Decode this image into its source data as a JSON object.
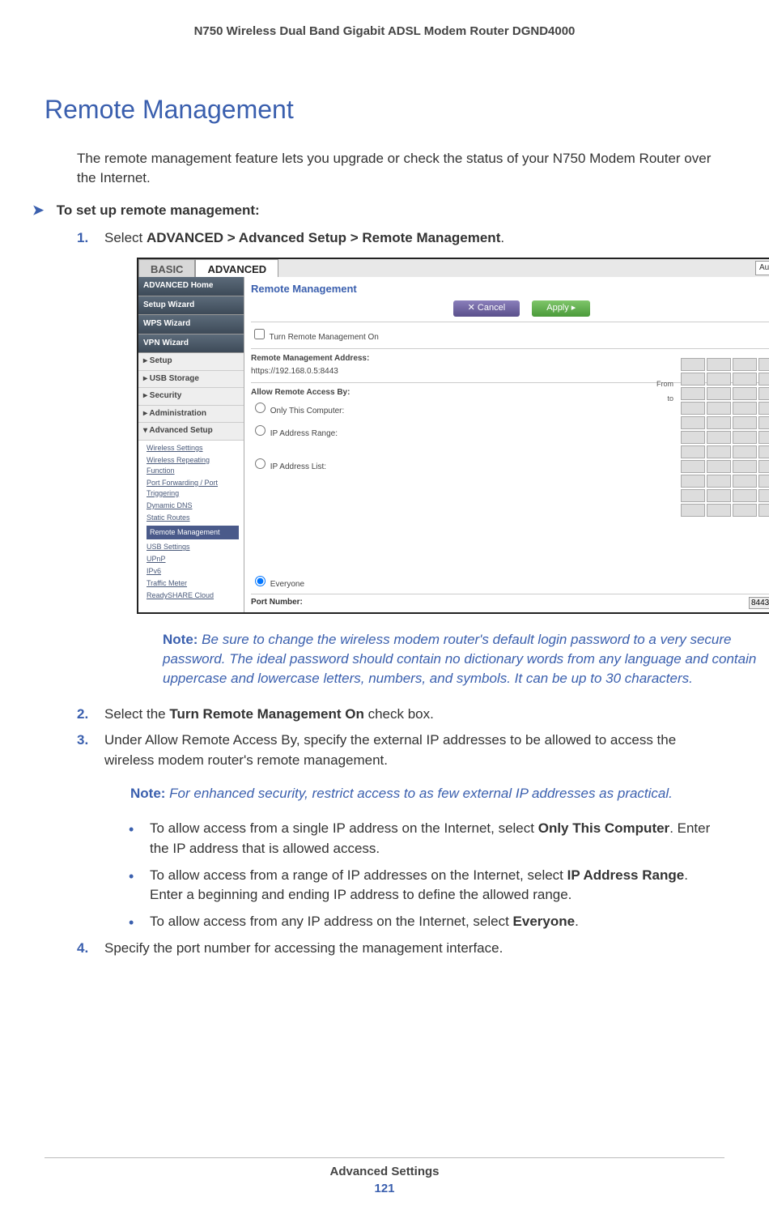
{
  "header": "N750 Wireless Dual Band Gigabit ADSL Modem Router DGND4000",
  "title": "Remote Management",
  "intro": "The remote management feature lets you upgrade or check the status of your N750 Modem Router over the Internet.",
  "proc_heading": "To set up remote management:",
  "steps": {
    "s1_pre": "Select ",
    "s1_bold": "ADVANCED > Advanced Setup > Remote Management",
    "s1_post": ".",
    "s2_pre": "Select the ",
    "s2_bold": "Turn Remote Management On",
    "s2_post": " check box.",
    "s3": "Under Allow Remote Access By, specify the external IP addresses to be allowed to access the wireless modem router's remote management.",
    "s4": "Specify the port number for accessing the management interface."
  },
  "note1_label": "Note:",
  "note1": " Be sure to change the wireless modem router's default login password to a very secure password. The ideal password should contain no dictionary words from any language and contain uppercase and lowercase letters, numbers, and symbols. It can be up to 30 characters.",
  "note2_label": "Note:",
  "note2": " For enhanced security, restrict access to as few external IP addresses as practical.",
  "sub": {
    "a_pre": "To allow access from a single IP address on the Internet, select ",
    "a_bold": "Only This Computer",
    "a_post": ". Enter the IP address that is allowed access.",
    "b_pre": "To allow access from a range of IP addresses on the Internet, select ",
    "b_bold": "IP Address Range",
    "b_post": ". Enter a beginning and ending IP address to define the allowed range.",
    "c_pre": "To allow access from any IP address on the Internet, select ",
    "c_bold": "Everyone",
    "c_post": "."
  },
  "screenshot": {
    "tab_basic": "BASIC",
    "tab_adv": "ADVANCED",
    "auto": "Auto",
    "side": {
      "adv_home": "ADVANCED Home",
      "setup_wiz": "Setup Wizard",
      "wps_wiz": "WPS Wizard",
      "vpn_wiz": "VPN Wizard",
      "setup": "▸ Setup",
      "usb": "▸ USB Storage",
      "security": "▸ Security",
      "admin": "▸ Administration",
      "advsetup": "▾ Advanced Setup",
      "sub_wireless": "Wireless Settings",
      "sub_repeat": "Wireless Repeating Function",
      "sub_port": "Port Forwarding / Port Triggering",
      "sub_dns": "Dynamic DNS",
      "sub_routes": "Static Routes",
      "sub_remote": "Remote Management",
      "sub_usb": "USB Settings",
      "sub_upnp": "UPnP",
      "sub_ipv6": "IPv6",
      "sub_traffic": "Traffic Meter",
      "sub_ready": "ReadySHARE Cloud"
    },
    "panel_title": "Remote Management",
    "btn_cancel": "✕   Cancel",
    "btn_apply": "Apply   ▸",
    "chk_turn_on": "Turn Remote Management On",
    "addr_label": "Remote Management Address:",
    "addr_value": "https://192.168.0.5:8443",
    "allow_label": "Allow Remote Access By:",
    "opt_only": "Only This Computer:",
    "opt_range": "IP Address Range:",
    "opt_list": "IP Address List:",
    "opt_everyone": "Everyone",
    "from": "From",
    "to": "to",
    "port_label": "Port Number:",
    "port_value": "8443"
  },
  "footer": {
    "section": "Advanced Settings",
    "page": "121"
  }
}
